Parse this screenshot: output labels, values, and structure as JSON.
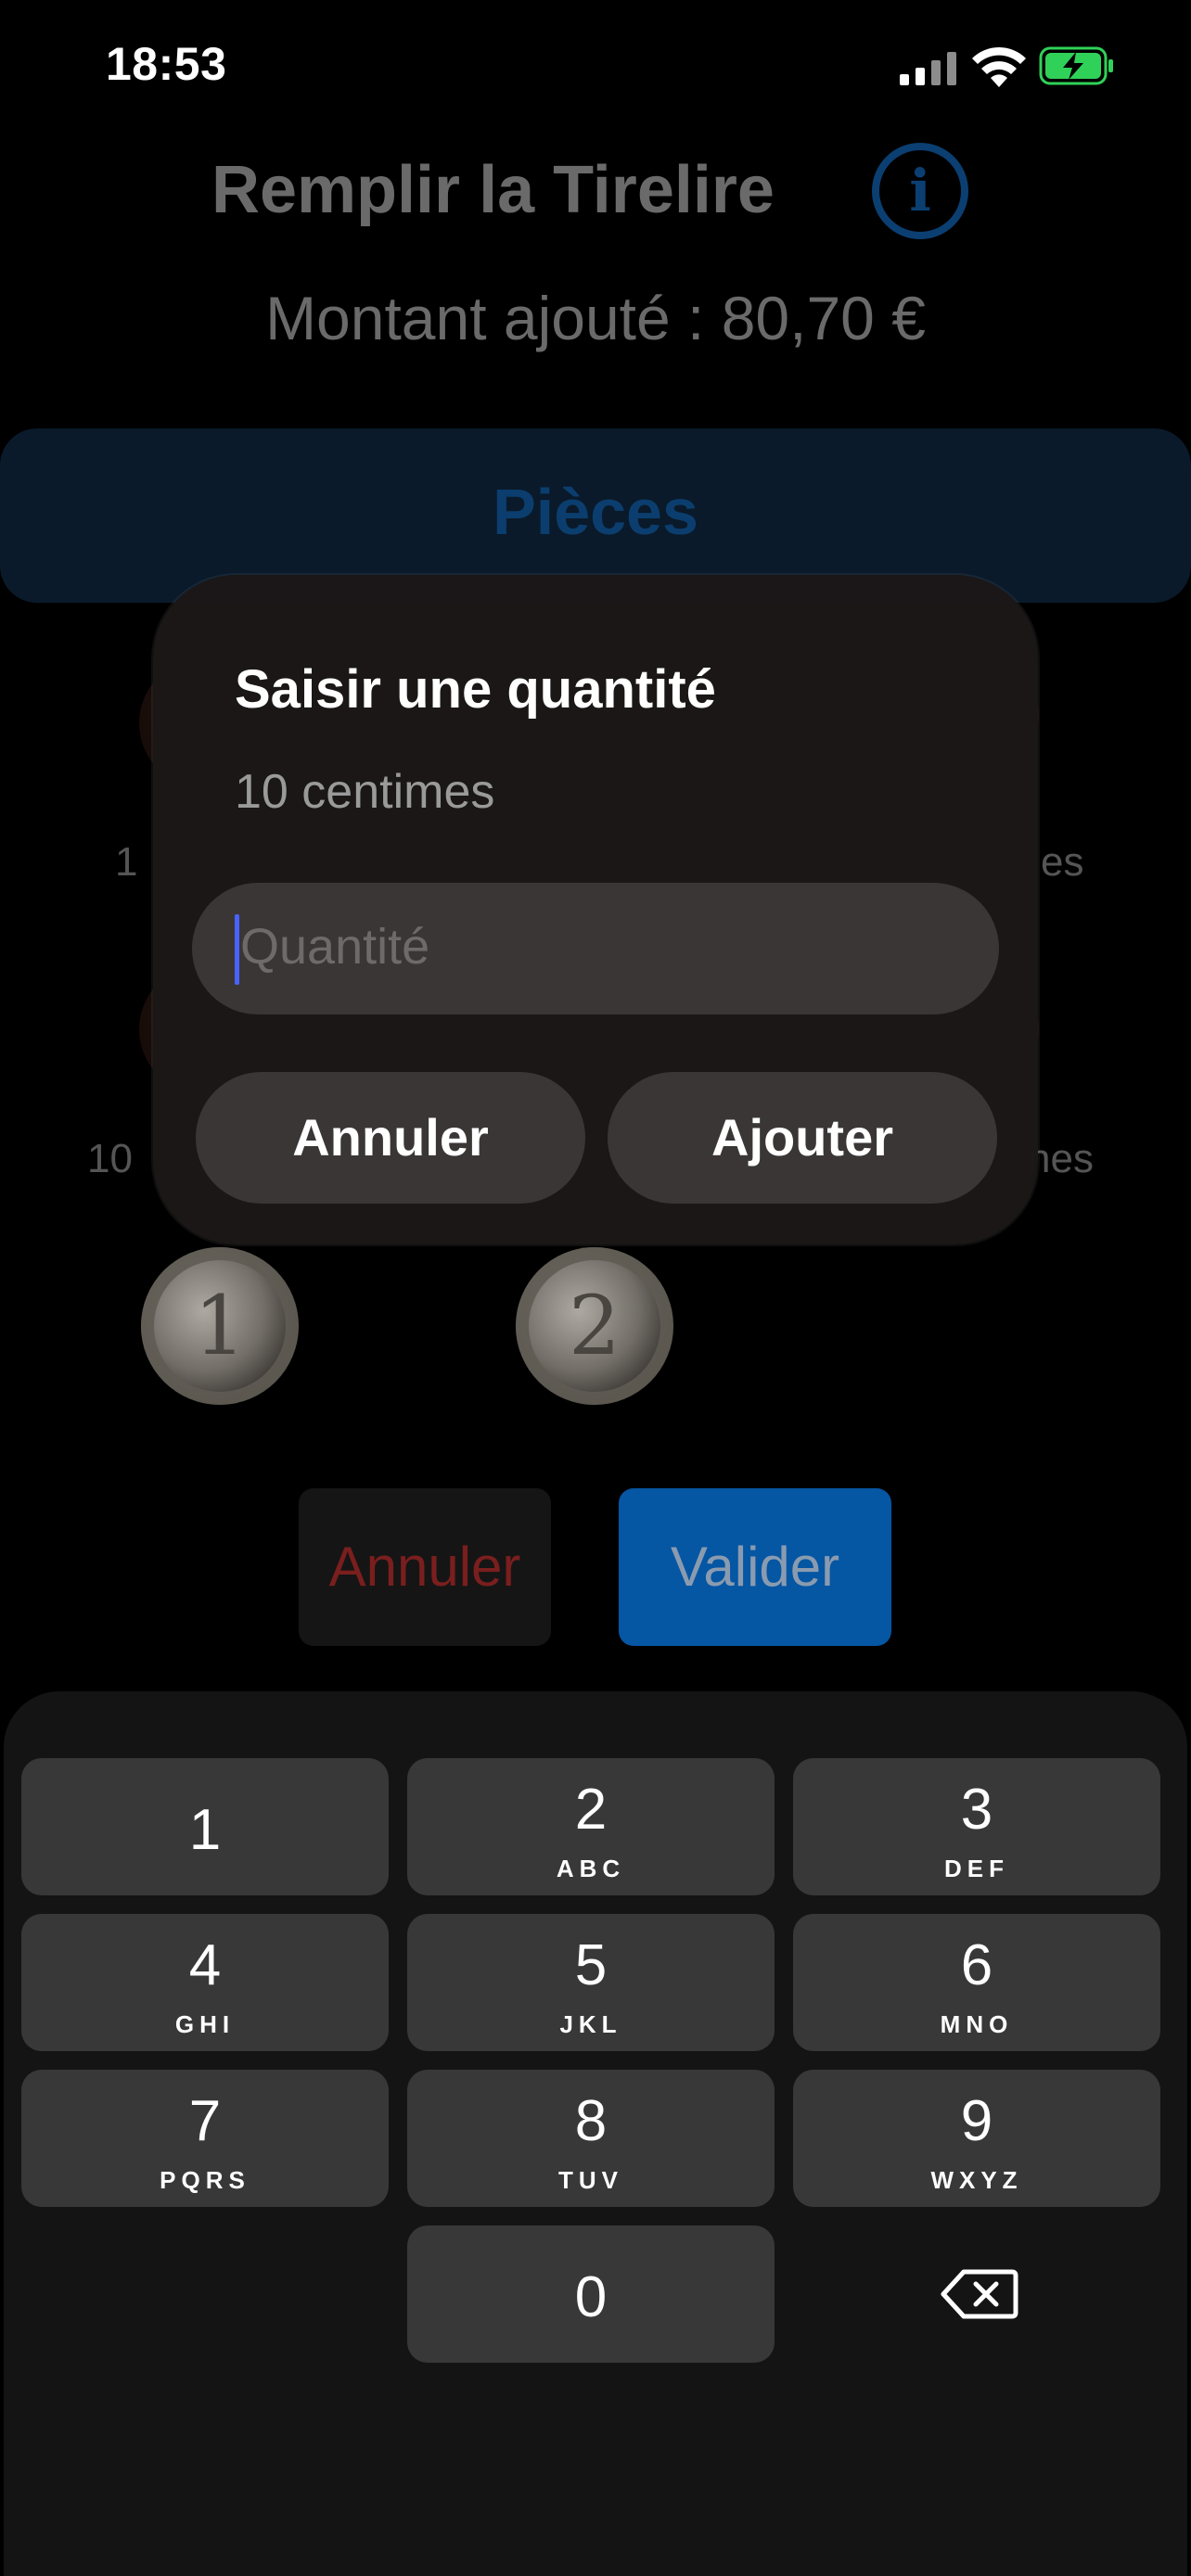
{
  "status_bar": {
    "time": "18:53"
  },
  "header": {
    "title": "Remplir la Tirelire",
    "amount_text": "Montant ajouté : 80,70 €"
  },
  "tab": {
    "label": "Pièces"
  },
  "background_labels": {
    "left_1": "1",
    "left_2": "10",
    "right_1": "es",
    "right_2": "nes"
  },
  "coins": {
    "one_euro": "1",
    "two_euro": "2"
  },
  "actions": {
    "cancel_label": "Annuler",
    "validate_label": "Valider"
  },
  "dialog": {
    "title": "Saisir une quantité",
    "subtitle": "10 centimes",
    "input_placeholder": "Quantité",
    "cancel_label": "Annuler",
    "add_label": "Ajouter"
  },
  "keyboard": {
    "keys": [
      {
        "num": "1",
        "letters": ""
      },
      {
        "num": "2",
        "letters": "ABC"
      },
      {
        "num": "3",
        "letters": "DEF"
      },
      {
        "num": "4",
        "letters": "GHI"
      },
      {
        "num": "5",
        "letters": "JKL"
      },
      {
        "num": "6",
        "letters": "MNO"
      },
      {
        "num": "7",
        "letters": "PQRS"
      },
      {
        "num": "8",
        "letters": "TUV"
      },
      {
        "num": "9",
        "letters": "WXYZ"
      },
      {
        "num": "0",
        "letters": ""
      }
    ],
    "delete_icon": "delete-backspace-icon"
  },
  "colors": {
    "accent_blue": "#0556a3",
    "danger_red": "#7a1e1e",
    "caret": "#4a63ff",
    "battery_green": "#30d158"
  }
}
